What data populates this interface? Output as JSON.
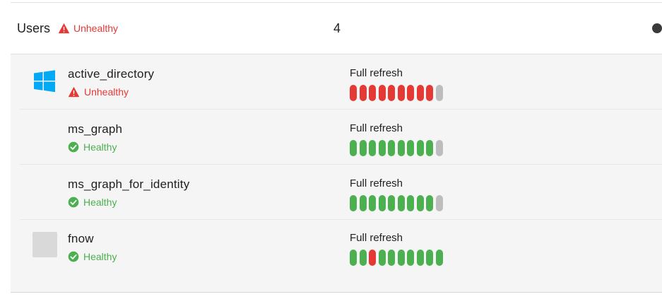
{
  "group": {
    "title": "Users",
    "status": "Unhealthy",
    "count": "4"
  },
  "colors": {
    "unhealthy": "#e53935",
    "healthy": "#4caf50",
    "no_data": "#bdbdbd",
    "windows_logo": "#03a9f4"
  },
  "connectors": [
    {
      "name": "active_directory",
      "icon": "windows-logo-icon",
      "health": "Unhealthy",
      "sync_type": "Full refresh",
      "history": [
        "fail",
        "fail",
        "fail",
        "fail",
        "fail",
        "fail",
        "fail",
        "fail",
        "fail",
        "none"
      ]
    },
    {
      "name": "ms_graph",
      "icon": "none",
      "health": "Healthy",
      "sync_type": "Full refresh",
      "history": [
        "ok",
        "ok",
        "ok",
        "ok",
        "ok",
        "ok",
        "ok",
        "ok",
        "ok",
        "none"
      ]
    },
    {
      "name": "ms_graph_for_identity",
      "icon": "none",
      "health": "Healthy",
      "sync_type": "Full refresh",
      "history": [
        "ok",
        "ok",
        "ok",
        "ok",
        "ok",
        "ok",
        "ok",
        "ok",
        "ok",
        "none"
      ]
    },
    {
      "name": "fnow",
      "icon": "placeholder-icon",
      "health": "Healthy",
      "sync_type": "Full refresh",
      "history": [
        "ok",
        "ok",
        "fail",
        "ok",
        "ok",
        "ok",
        "ok",
        "ok",
        "ok",
        "ok"
      ]
    }
  ]
}
